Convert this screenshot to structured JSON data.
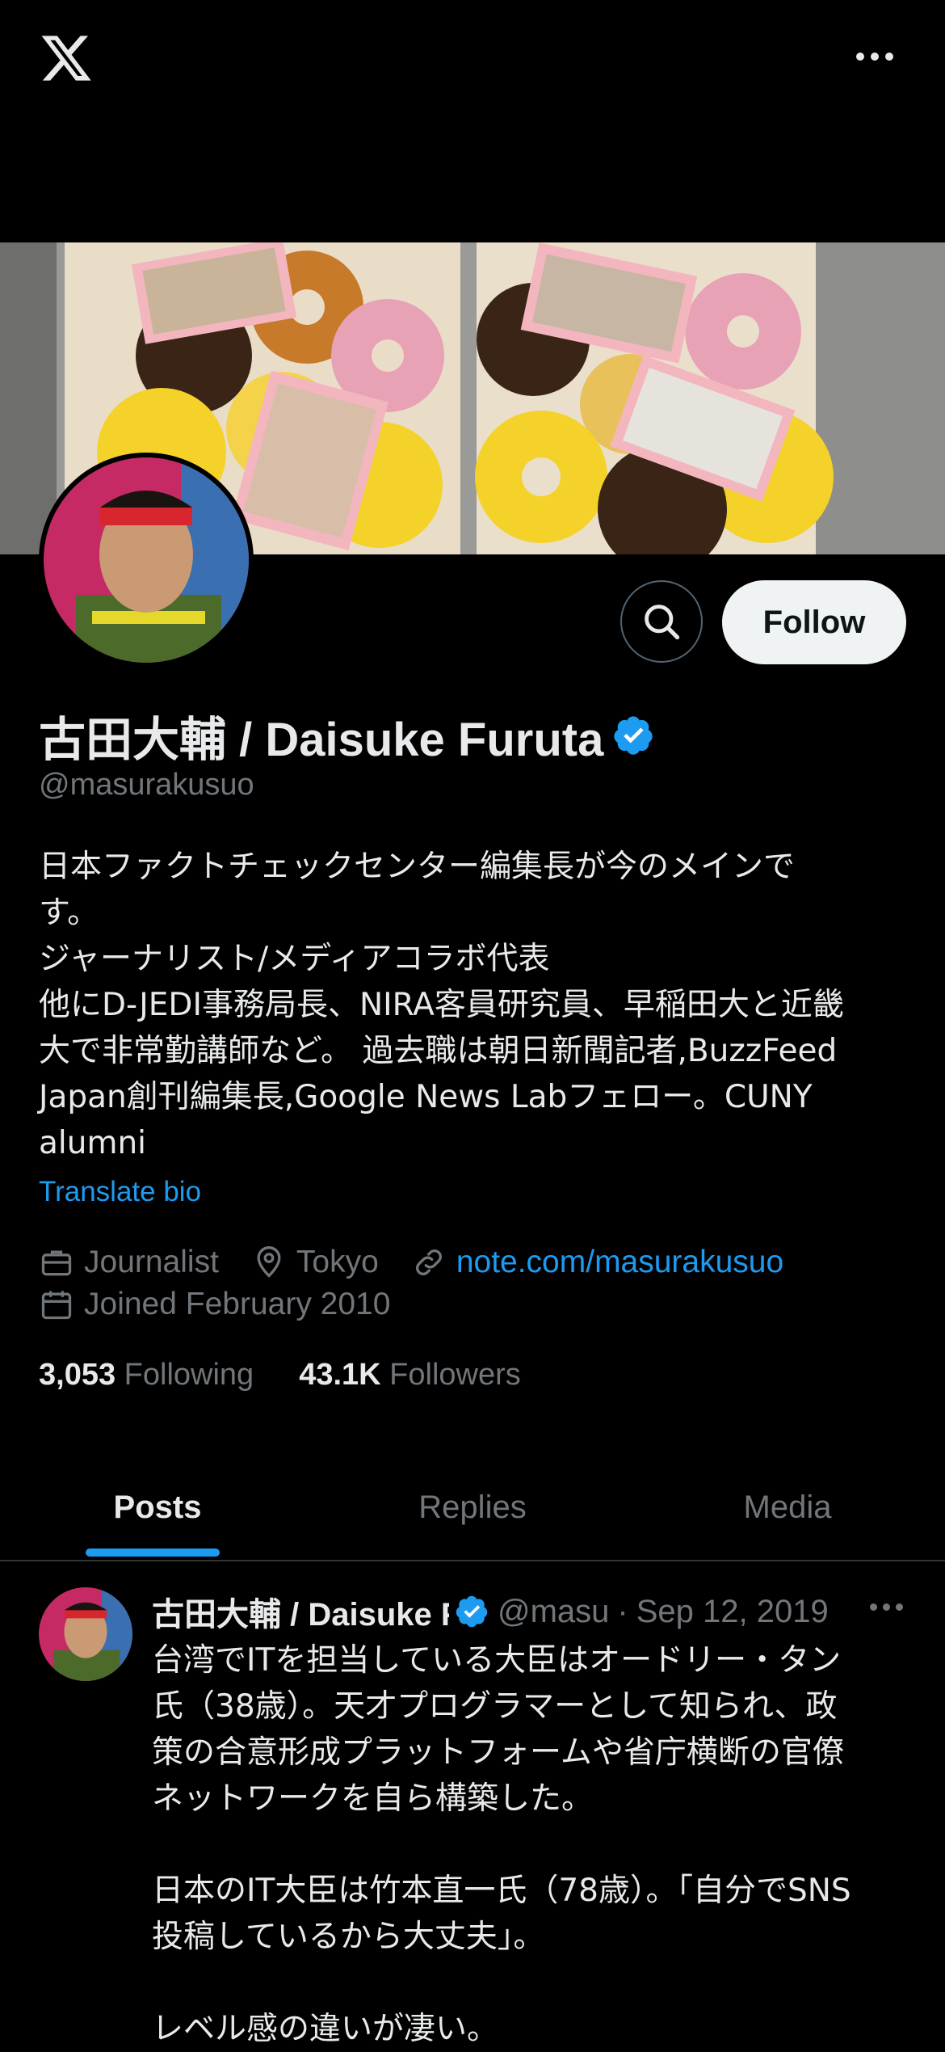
{
  "topbar": {
    "logo_icon": "x-logo-icon",
    "more_icon": "more-horizontal-icon"
  },
  "profile": {
    "name": "古田大輔 / Daisuke Furuta",
    "verified_icon": "verified-badge-icon",
    "handle": "@masurakusuo",
    "bio": "日本ファクトチェックセンター編集長が今のメインで\nす。\nジャーナリスト/メディアコラボ代表\n他にD-JEDI事務局長、NIRA客員研究員、早稲田大と近畿\n大で非常勤講師など。 過去職は朝日新聞記者,BuzzFeed\nJapan創刊編集長,Google News Labフェロー。CUNY\nalumni",
    "translate_label": "Translate bio",
    "profession": "Journalist",
    "location": "Tokyo",
    "website": "note.com/masurakusuo",
    "joined": "Joined February 2010",
    "following_count": "3,053",
    "following_label": "Following",
    "followers_count": "43.1K",
    "followers_label": "Followers"
  },
  "actions": {
    "follow_label": "Follow",
    "search_icon": "search-icon"
  },
  "tabs": [
    {
      "label": "Posts",
      "active": true
    },
    {
      "label": "Replies",
      "active": false
    },
    {
      "label": "Media",
      "active": false
    }
  ],
  "post": {
    "author_name": "古田大輔 / Daisuke Furuta",
    "handle": "@masu",
    "separator": "·",
    "date": "Sep 12, 2019",
    "text": "台湾でITを担当している大臣はオードリー・タン\n氏（38歳）。天才プログラマーとして知られ、政\n策の合意形成プラットフォームや省庁横断の官僚\nネットワークを自ら構築した。\n\n日本のIT大臣は竹本直一氏（78歳）。「自分でSNS\n投稿しているから大丈夫」。\n\nレベル感の違いが凄い。"
  },
  "colors": {
    "accent": "#1d9bf0",
    "background": "#000000",
    "muted": "#71767b",
    "text": "#e7e9ea"
  }
}
